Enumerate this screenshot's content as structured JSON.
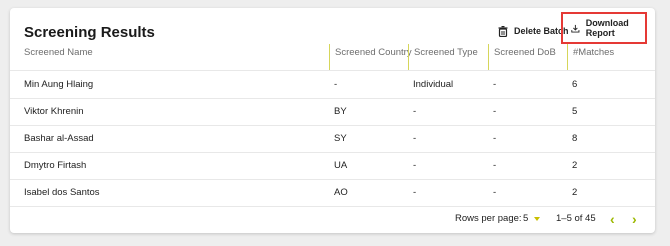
{
  "title": "Screening Results",
  "actions": {
    "delete_label": "Delete Batch",
    "download_label": "Download Report"
  },
  "columns": [
    "Screened Name",
    "Screened Country",
    "Screened Type",
    "Screened DoB",
    "#Matches"
  ],
  "rows": [
    {
      "name": "Min Aung Hlaing",
      "country": "-",
      "type": "Individual",
      "dob": "-",
      "matches": "6"
    },
    {
      "name": "Viktor Khrenin",
      "country": "BY",
      "type": "-",
      "dob": "-",
      "matches": "5"
    },
    {
      "name": "Bashar al-Assad",
      "country": "SY",
      "type": "-",
      "dob": "-",
      "matches": "8"
    },
    {
      "name": "Dmytro Firtash",
      "country": "UA",
      "type": "-",
      "dob": "-",
      "matches": "2"
    },
    {
      "name": "Isabel dos Santos",
      "country": "AO",
      "type": "-",
      "dob": "-",
      "matches": "2"
    }
  ],
  "pagination": {
    "rows_per_page_label": "Rows per page:",
    "rows_per_page": "5",
    "range": "1–5 of 45",
    "prev": "‹",
    "next": "›"
  },
  "colors": {
    "highlight_border": "#e53935",
    "accent": "#c9bf00",
    "column_separator": "#d6d65a"
  }
}
